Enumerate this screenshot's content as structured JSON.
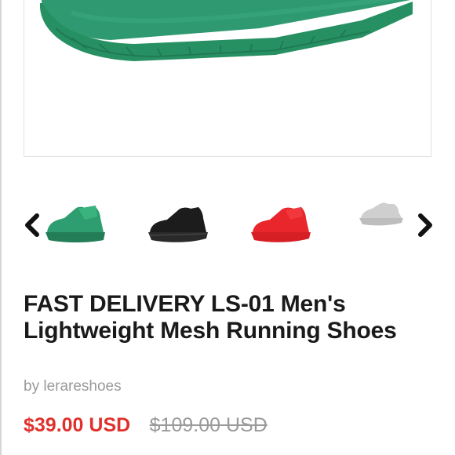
{
  "product": {
    "title_line1": "FAST DELIVERY LS-01 Men's",
    "title_line2": "Lightweight Mesh Running Shoes",
    "vendor": "by lerareshoes",
    "price": "$39.00 USD",
    "compare_price": "$109.00 USD"
  },
  "gallery": {
    "main_color": "green",
    "thumbnails": [
      {
        "color_name": "green",
        "color": "#2e9e70"
      },
      {
        "color_name": "black",
        "color": "#1c1c1c"
      },
      {
        "color_name": "red",
        "color": "#e8262c"
      },
      {
        "color_name": "grey",
        "color": "#c8c8c8"
      }
    ],
    "prev_icon": "chevron-left-icon",
    "next_icon": "chevron-right-icon"
  },
  "colors": {
    "price": "#e0312c",
    "text": "#1a1a1a",
    "muted": "#9a9a9a"
  }
}
